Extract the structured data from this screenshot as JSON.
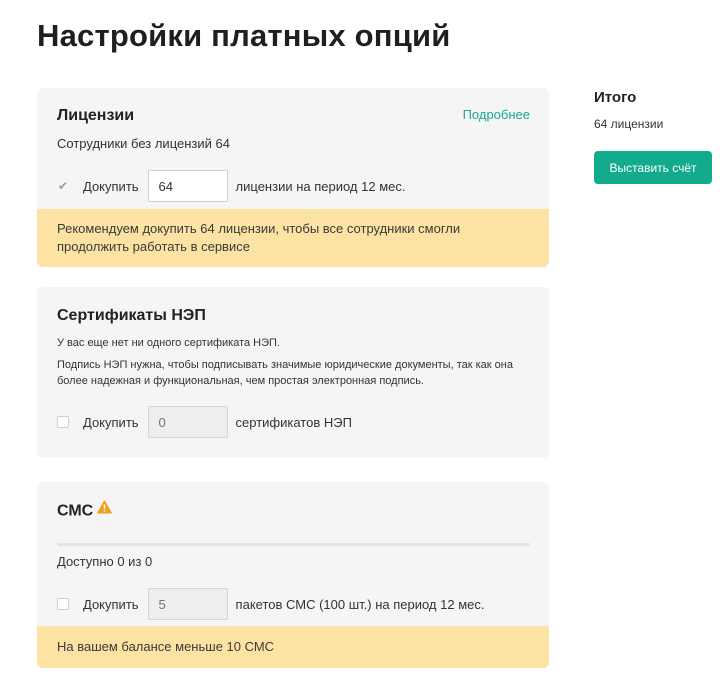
{
  "page": {
    "title": "Настройки платных опций"
  },
  "licenses": {
    "title": "Лицензии",
    "more_link": "Подробнее",
    "employees_without": "Сотрудники без лицензий 64",
    "buy_label": "Докупить",
    "quantity": "64",
    "after_label": "лицензии на период 12 мес.",
    "notice": "Рекомендуем докупить 64 лицензии, чтобы все сотрудники смогли продолжить работать в сервисе"
  },
  "certificates": {
    "title": "Сертификаты НЭП",
    "no_cert": "У вас еще нет ни одного сертификата НЭП.",
    "description": "Подпись НЭП нужна, чтобы подписывать значимые юридические документы, так как она более надежная и функциональная, чем простая электронная подпись.",
    "buy_label": "Докупить",
    "placeholder": "0",
    "after_label": "сертификатов НЭП"
  },
  "sms": {
    "title": "СМС",
    "available": "Доступно 0 из 0",
    "buy_label": "Докупить",
    "placeholder": "5",
    "after_label": "пакетов СМС (100 шт.) на период 12 мес.",
    "notice": "На вашем балансе меньше 10 СМС"
  },
  "summary": {
    "title": "Итого",
    "count": "64 лицензии",
    "invoice_button": "Выставить счёт"
  },
  "colors": {
    "accent": "#13ab8e",
    "link": "#1aa98f",
    "warning_bg": "#fde3a3",
    "warning_icon": "#f0a020",
    "card_bg": "#f5f5f5"
  }
}
